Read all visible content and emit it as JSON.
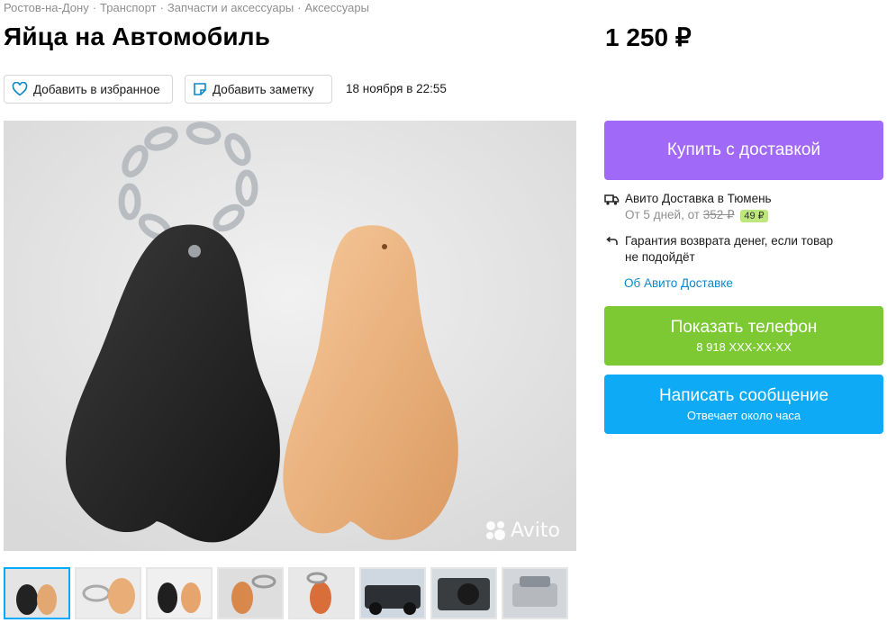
{
  "breadcrumb": [
    "Ростов-на-Дону",
    "Транспорт",
    "Запчасти и аксессуары",
    "Аксессуары"
  ],
  "title": "Яйца на Автомобиль",
  "price": "1 250 ₽",
  "actions": {
    "favorite_label": "Добавить в избранное",
    "note_label": "Добавить заметку",
    "date": "18 ноября в 22:55"
  },
  "gallery": {
    "watermark": "Avito",
    "thumbnail_count": 8,
    "active_thumbnail": 1
  },
  "purchase": {
    "buy_label": "Купить с доставкой",
    "delivery_title": "Авито Доставка в Тюмень",
    "delivery_prefix": "От 5 дней, от",
    "delivery_old_price": "352 ₽",
    "delivery_price": "49 ₽",
    "guarantee_line1": "Гарантия возврата денег, если товар",
    "guarantee_line2": "не подойдёт",
    "about_link": "Об Авито Доставке"
  },
  "contact": {
    "phone_label": "Показать телефон",
    "phone_number": "8 918 XXX-XX-XX",
    "message_label": "Написать сообщение",
    "message_sub": "Отвечает около часа"
  },
  "colors": {
    "buy": "#a169f7",
    "phone": "#7cc934",
    "message": "#0eaaf5",
    "link": "#0a88c9",
    "badge": "#bde67e"
  }
}
